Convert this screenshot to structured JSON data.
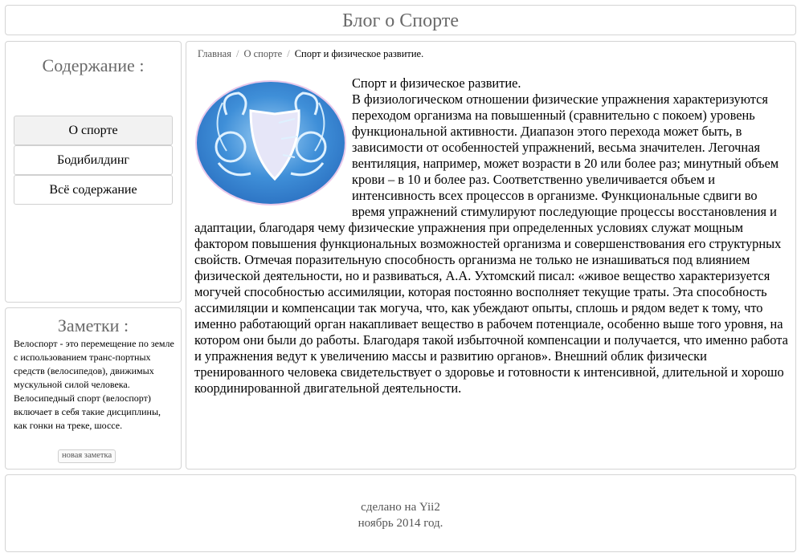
{
  "header": {
    "title": "Блог о Спорте"
  },
  "sidebar": {
    "heading": "Содержание :",
    "items": [
      {
        "label": "О спорте",
        "active": true
      },
      {
        "label": "Бодибилдинг",
        "active": false
      },
      {
        "label": "Всё содержание",
        "active": false
      }
    ]
  },
  "notes": {
    "heading": "Заметки :",
    "text": "Велоспорт - это перемещение по земле с использованием транс-портных средств (велосипедов), движимых мускульной силой человека. Велосипедный спорт (велоспорт) включает в себя такие дисциплины, как гонки на треке, шоссе.",
    "new_note_label": "новая заметка"
  },
  "breadcrumb": {
    "home": "Главная",
    "section": "О спорте",
    "current": "Спорт и физическое развитие."
  },
  "article": {
    "title": "Спорт и физическое развитие.",
    "body": "В физиологическом отношении физические упражнения характеризуются переходом организма на повышенный (сравнительно с покоем) уровень функциональной активности. Диапазон этого перехода может быть, в зависимости от особенностей упражнений, весьма значителен. Легочная вентиляция, например, может возрасти в 20 или более раз; минутный объем крови – в 10 и более раз. Соответственно увеличивается объем и интенсивность всех процессов в организме. Функциональные сдвиги во время упражнений стимулируют последующие процессы восстановления и адаптации, благодаря чему физические упражнения при определенных условиях служат мощным фактором повышения функциональных возможностей организма и совершенствования его структурных свойств. Отмечая поразительную способность организма не только не изнашиваться под влиянием физической деятельности, но и развиваться, А.А. Ухтомский писал: «живое вещество характеризуется могучей способностью ассимиляции, которая постоянно восполняет текущие траты. Эта способность ассимиляции и компенсации так могуча, что, как убеждают опыты, сплошь и рядом ведет к тому, что именно работающий орган накапливает вещество в рабочем потенциале, особенно выше того уровня, на котором они были до работы. Благодаря такой избыточной компенсации и получается, что именно работа и упражнения ведут к увеличению массы и развитию органов». Внешний облик физически тренированного человека свидетельствует о здоровье и готовности к интенсивной, длительной и хорошо координированной двигательной деятельности.",
    "image_icon": "athletes-shield-emblem"
  },
  "footer": {
    "line1": "сделано на Yii2",
    "line2": "ноябрь 2014 год."
  },
  "colors": {
    "border": "#d4d4d4",
    "heading_text": "#6a6a6a",
    "emblem_blue": "#3f8fd8",
    "emblem_shield": "#e6e6f8"
  }
}
